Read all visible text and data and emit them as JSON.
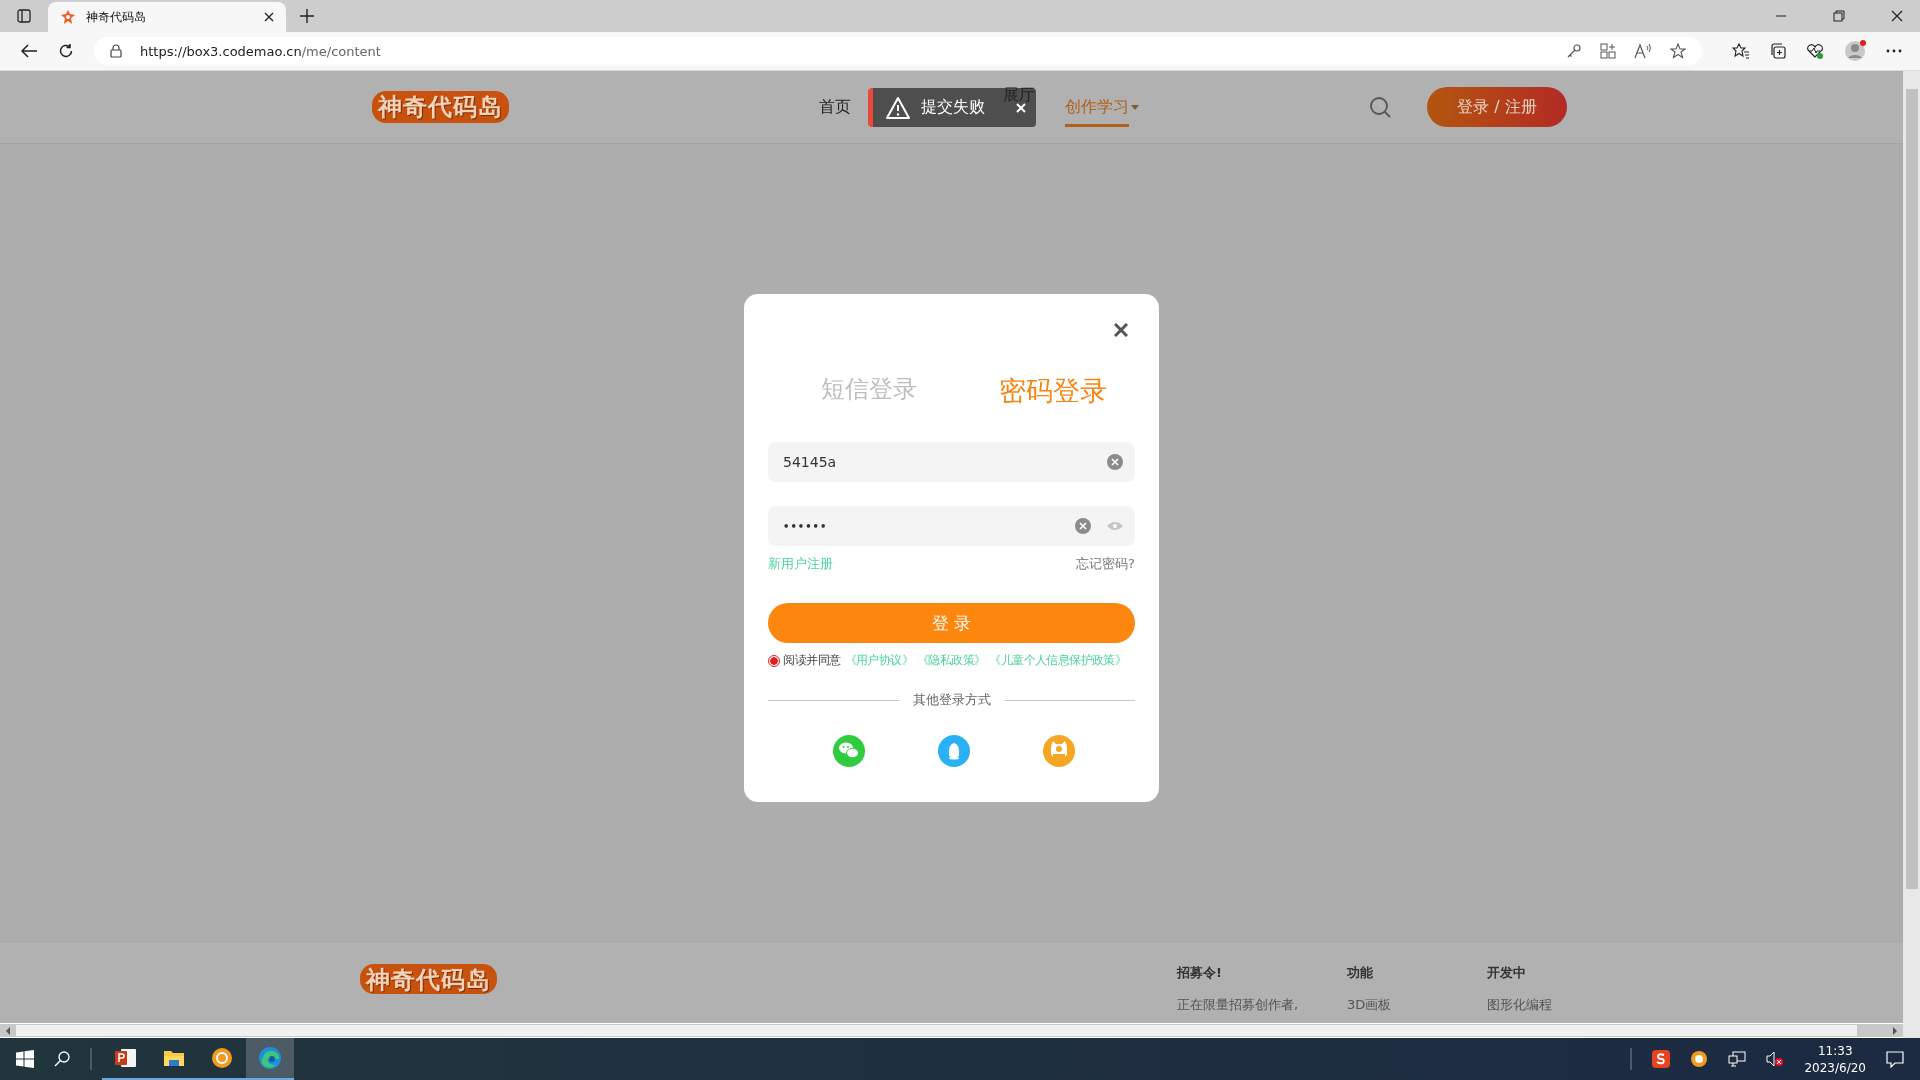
{
  "browser": {
    "tab_title": "神奇代码岛",
    "url_host": "https://box3.codemao.cn",
    "url_path": "/me/content"
  },
  "site_header": {
    "logo": "神奇代码岛",
    "nav": [
      {
        "label": "首页",
        "selected": false
      },
      {
        "label": "展厅",
        "selected": false
      },
      {
        "label": "创作学习",
        "selected": true
      }
    ],
    "login_button": "登录 / 注册"
  },
  "toast": {
    "text": "提交失败"
  },
  "dialog": {
    "tabs": [
      {
        "label": "短信登录",
        "selected": false
      },
      {
        "label": "密码登录",
        "selected": true
      }
    ],
    "username": {
      "value": "54145a"
    },
    "password": {
      "value": "••••••"
    },
    "register_link": "新用户注册",
    "forgot_link": "忘记密码?",
    "submit": "登 录",
    "agreement": {
      "checked": true,
      "text": "阅读并同意",
      "links": [
        "《用户协议》",
        "《隐私政策》",
        "《儿童个人信息保护政策》"
      ]
    },
    "other_login": "其他登录方式"
  },
  "footer": {
    "logo": "神奇代码岛",
    "columns": [
      {
        "heading": "招募令!",
        "item": "正在限量招募创作者,"
      },
      {
        "heading": "功能",
        "item": "3D画板"
      },
      {
        "heading": "开发中",
        "item": "图形化编程"
      }
    ]
  },
  "taskbar": {
    "time": "11:33",
    "date": "2023/6/20"
  }
}
